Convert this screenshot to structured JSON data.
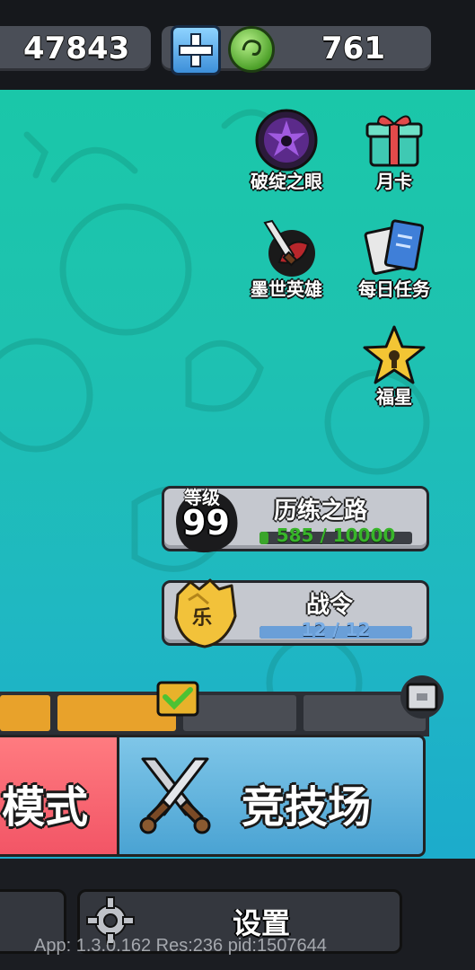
{
  "currency": {
    "gold": "47843",
    "gems": "761"
  },
  "side_menu": {
    "items": [
      {
        "label": "破绽之眼",
        "icon": "dark-eye-icon"
      },
      {
        "label": "月卡",
        "icon": "gift-box-icon"
      },
      {
        "label": "墨世英雄",
        "icon": "ink-blade-icon"
      },
      {
        "label": "每日任务",
        "icon": "task-cards-icon"
      },
      {
        "label": "福星",
        "icon": "lucky-star-icon"
      }
    ]
  },
  "trial_road": {
    "level_label": "等级",
    "level": "99",
    "title": "历练之路",
    "progress_text": "585 / 10000",
    "progress_value": 585,
    "progress_max": 10000
  },
  "battle_pass": {
    "title": "战令",
    "badge_glyph": "乐",
    "progress_text": "12 / 12",
    "progress_value": 12,
    "progress_max": 12
  },
  "modes": {
    "left_label": "模式",
    "right_label": "竞技场"
  },
  "bottom": {
    "settings_label": "设置"
  },
  "debug_text": "App: 1.3.0.162 Res:236 pid:1507644",
  "colors": {
    "bg_top": "#19c9a6",
    "bg_bottom": "#1aa6d0",
    "tab_active": "#e8a22b",
    "mode_left": "#f25566",
    "mode_right": "#4aa3d3",
    "progress_green": "#3aa52b",
    "progress_blue": "#6a9fd8"
  }
}
